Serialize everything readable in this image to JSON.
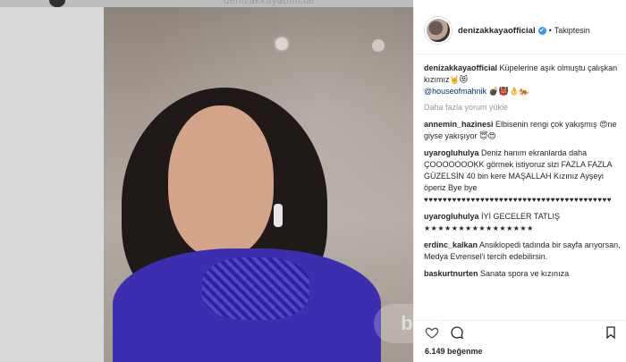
{
  "backdrop": {
    "top_text": "denizakkayaofficial"
  },
  "post": {
    "username": "denizakkayaofficial",
    "verified_mark": "✔",
    "separator": "•",
    "follow_status": "Takiptesin",
    "caption": {
      "user": "denizakkayaofficial",
      "text": " Küpelerine aşık olmuştu çalışkan kızımız🤘😻",
      "mention": "@houseofmahnik",
      "emoji_tail": " 💣👹👌🐅"
    },
    "load_more": "Daha fazla yorum yükle",
    "comments": [
      {
        "user": "annemin_hazinesi",
        "text": " Elbisenin rengi çok yakışmış 😍ne giyse yakışıyor 😇😍"
      },
      {
        "user": "uyarogluhulya",
        "text": " Deniz hanım ekranlarda daha ÇOOOOOOOKK görmek istiyoruz sizi FAZLA FAZLA GÜZELSİN 40 bin kere MAŞALLAH Kızınız Ayşeyi öperiz Bye bye",
        "hearts": "♥♥♥♥♥♥♥♥♥♥♥♥♥♥♥♥♥♥♥♥♥♥♥♥♥♥♥♥♥♥♥♥♥♥♥♥♥♥♥♥"
      },
      {
        "user": "uyarogluhulya",
        "text": " İYİ GECELER TATLIŞ",
        "stars": "★★★★★★★★★★★★★★★★"
      },
      {
        "user": "erdinc_kalkan",
        "text": " Ansiklopedi tadında bir sayfa arıyorsan, Medya Evrensel'i tercih edebilirsin."
      },
      {
        "user": "baskurtnurten",
        "text": " Sanata spora ve kızınıza"
      }
    ],
    "likes": "6.149 beğenme",
    "watermark": "b"
  },
  "icons": [
    "heart-icon",
    "comment-icon",
    "bookmark-icon",
    "verified-icon"
  ]
}
